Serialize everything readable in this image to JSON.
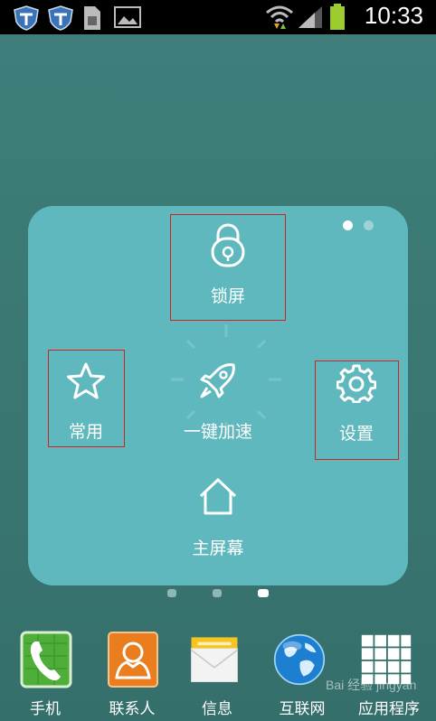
{
  "status_bar": {
    "time": "10:33",
    "icons": [
      "shield-icon",
      "shield-icon",
      "sim-icon",
      "image-icon",
      "wifi-icon",
      "signal-icon",
      "battery-icon"
    ]
  },
  "panel": {
    "items": {
      "lock": {
        "label": "锁屏",
        "icon": "lock-icon"
      },
      "favorites": {
        "label": "常用",
        "icon": "star-icon"
      },
      "boost": {
        "label": "一键加速",
        "icon": "rocket-icon"
      },
      "settings": {
        "label": "设置",
        "icon": "gear-icon"
      },
      "home": {
        "label": "主屏幕",
        "icon": "home-icon"
      }
    },
    "page_indicator": {
      "count": 2,
      "active": 1
    }
  },
  "home_pages": {
    "count": 3,
    "active": 3
  },
  "dock": [
    {
      "label": "手机",
      "icon": "phone-icon"
    },
    {
      "label": "联系人",
      "icon": "contacts-icon"
    },
    {
      "label": "信息",
      "icon": "messages-icon"
    },
    {
      "label": "互联网",
      "icon": "globe-icon"
    },
    {
      "label": "应用程序",
      "icon": "apps-grid-icon"
    }
  ],
  "watermark": "Bai 经验 jingyan"
}
